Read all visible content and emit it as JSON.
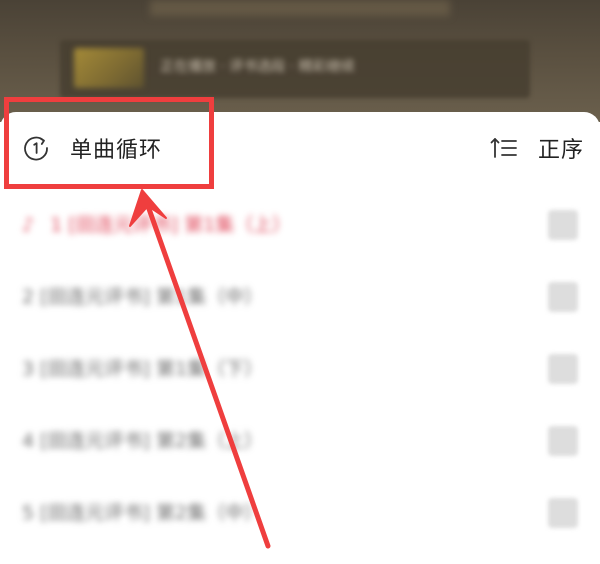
{
  "backdrop": {
    "banner_text": "正在播放 · 评书选段 · 精彩继续"
  },
  "header": {
    "play_mode": {
      "label": "单曲循环",
      "icon": "repeat-one-icon"
    },
    "sort_order": {
      "label": "正序",
      "icon": "sort-ascending-icon"
    }
  },
  "songs": [
    {
      "index": "1",
      "title": "[田连元评书] 第1集（上）",
      "active": true
    },
    {
      "index": "2",
      "title": "[田连元评书] 第1集（中）",
      "active": false
    },
    {
      "index": "3",
      "title": "[田连元评书] 第1集（下）",
      "active": false
    },
    {
      "index": "4",
      "title": "[田连元评书] 第2集（上）",
      "active": false
    },
    {
      "index": "5",
      "title": "[田连元评书] 第2集（中）",
      "active": false
    }
  ],
  "colors": {
    "accent": "#e0475a",
    "annotation": "#ef3e3e",
    "text": "#222222"
  }
}
